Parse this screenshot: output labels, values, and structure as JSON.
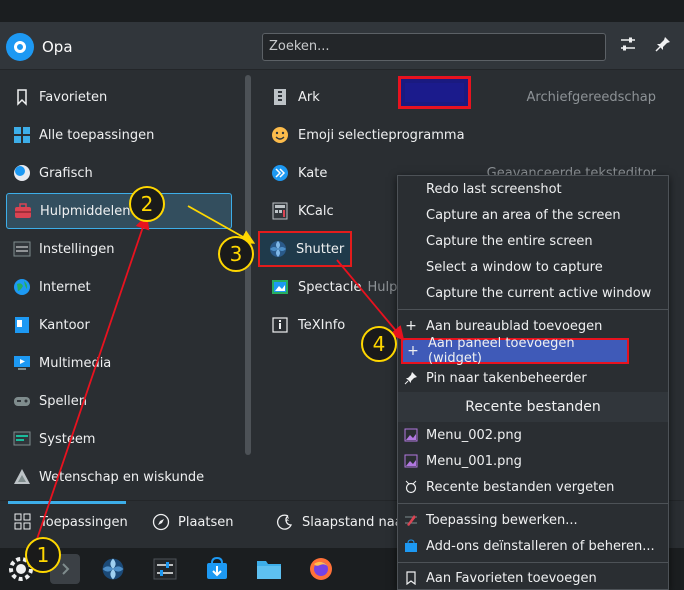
{
  "header": {
    "user_name": "Opa",
    "search_placeholder": "Zoeken..."
  },
  "categories": [
    {
      "label": "Favorieten"
    },
    {
      "label": "Alle toepassingen"
    },
    {
      "label": "Grafisch"
    },
    {
      "label": "Hulpmiddelen"
    },
    {
      "label": "Instellingen"
    },
    {
      "label": "Internet"
    },
    {
      "label": "Kantoor"
    },
    {
      "label": "Multimedia"
    },
    {
      "label": "Spellen"
    },
    {
      "label": "Systeem"
    },
    {
      "label": "Wetenschap en wiskunde"
    }
  ],
  "apps": [
    {
      "label": "Ark",
      "desc": "Archiefgereedschap"
    },
    {
      "label": "Emoji selectieprogramma",
      "desc": ""
    },
    {
      "label": "Kate",
      "desc": "Geavanceerde teksteditor"
    },
    {
      "label": "KCalc",
      "desc": ""
    },
    {
      "label": "Shutter",
      "desc": ""
    },
    {
      "label": "Spectacle",
      "desc": "Hulpm"
    },
    {
      "label": "TeXInfo",
      "desc": ""
    }
  ],
  "bottom_tabs": {
    "apps": "Toepassingen",
    "places": "Plaatsen",
    "sleep": "Slaapstand naar"
  },
  "context_menu": {
    "items_top": [
      "Redo last screenshot",
      "Capture an area of the screen",
      "Capture the entire screen",
      "Select a window to capture",
      "Capture the current active window"
    ],
    "add_desktop": "Aan bureaublad toevoegen",
    "add_panel": "Aan paneel toevoegen (widget)",
    "pin_taskmanager": "Pin naar takenbeheerder",
    "recent_header": "Recente bestanden",
    "recent_files": [
      "Menu_002.png",
      "Menu_001.png"
    ],
    "forget_recent": "Recente bestanden vergeten",
    "edit_app": "Toepassing bewerken...",
    "manage_addons": "Add-ons deïnstalleren of beheren...",
    "add_favorites": "Aan Favorieten toevoegen"
  },
  "callouts": [
    "1",
    "2",
    "3",
    "4"
  ],
  "colors": {
    "accent": "#3daee9",
    "annotation_red": "#e8121f",
    "annotation_yellow": "#ffd700"
  }
}
